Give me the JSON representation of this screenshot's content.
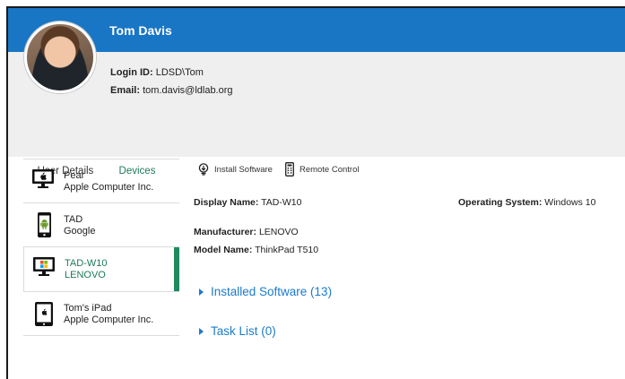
{
  "user": {
    "name": "Tom Davis",
    "login_label": "Login ID:",
    "login_value": "LDSD\\Tom",
    "email_label": "Email:",
    "email_value": "tom.davis@ldlab.org"
  },
  "tabs": [
    {
      "label": "User Details",
      "active": false
    },
    {
      "label": "Devices",
      "active": true
    }
  ],
  "devices": [
    {
      "name": "Pear",
      "maker": "Apple Computer Inc.",
      "icon": "desktop-apple-icon"
    },
    {
      "name": "TAD",
      "maker": "Google",
      "icon": "android-phone-icon"
    },
    {
      "name": "TAD-W10",
      "maker": "LENOVO",
      "icon": "desktop-windows-icon",
      "selected": true
    },
    {
      "name": "Tom's iPad",
      "maker": "Apple Computer Inc.",
      "icon": "tablet-apple-icon"
    }
  ],
  "toolbar": {
    "install_label": "Install Software",
    "remote_label": "Remote Control"
  },
  "details": {
    "display_name_label": "Display Name:",
    "display_name_value": "TAD-W10",
    "os_label": "Operating System:",
    "os_value": "Windows 10",
    "manufacturer_label": "Manufacturer:",
    "manufacturer_value": "LENOVO",
    "model_label": "Model Name:",
    "model_value": "ThinkPad T510"
  },
  "sections": {
    "installed_software": "Installed Software (13)",
    "task_list": "Task List (0)"
  },
  "colors": {
    "header": "#1976c5",
    "accent_green": "#1f8a5e",
    "link_blue": "#1b7bc9"
  }
}
